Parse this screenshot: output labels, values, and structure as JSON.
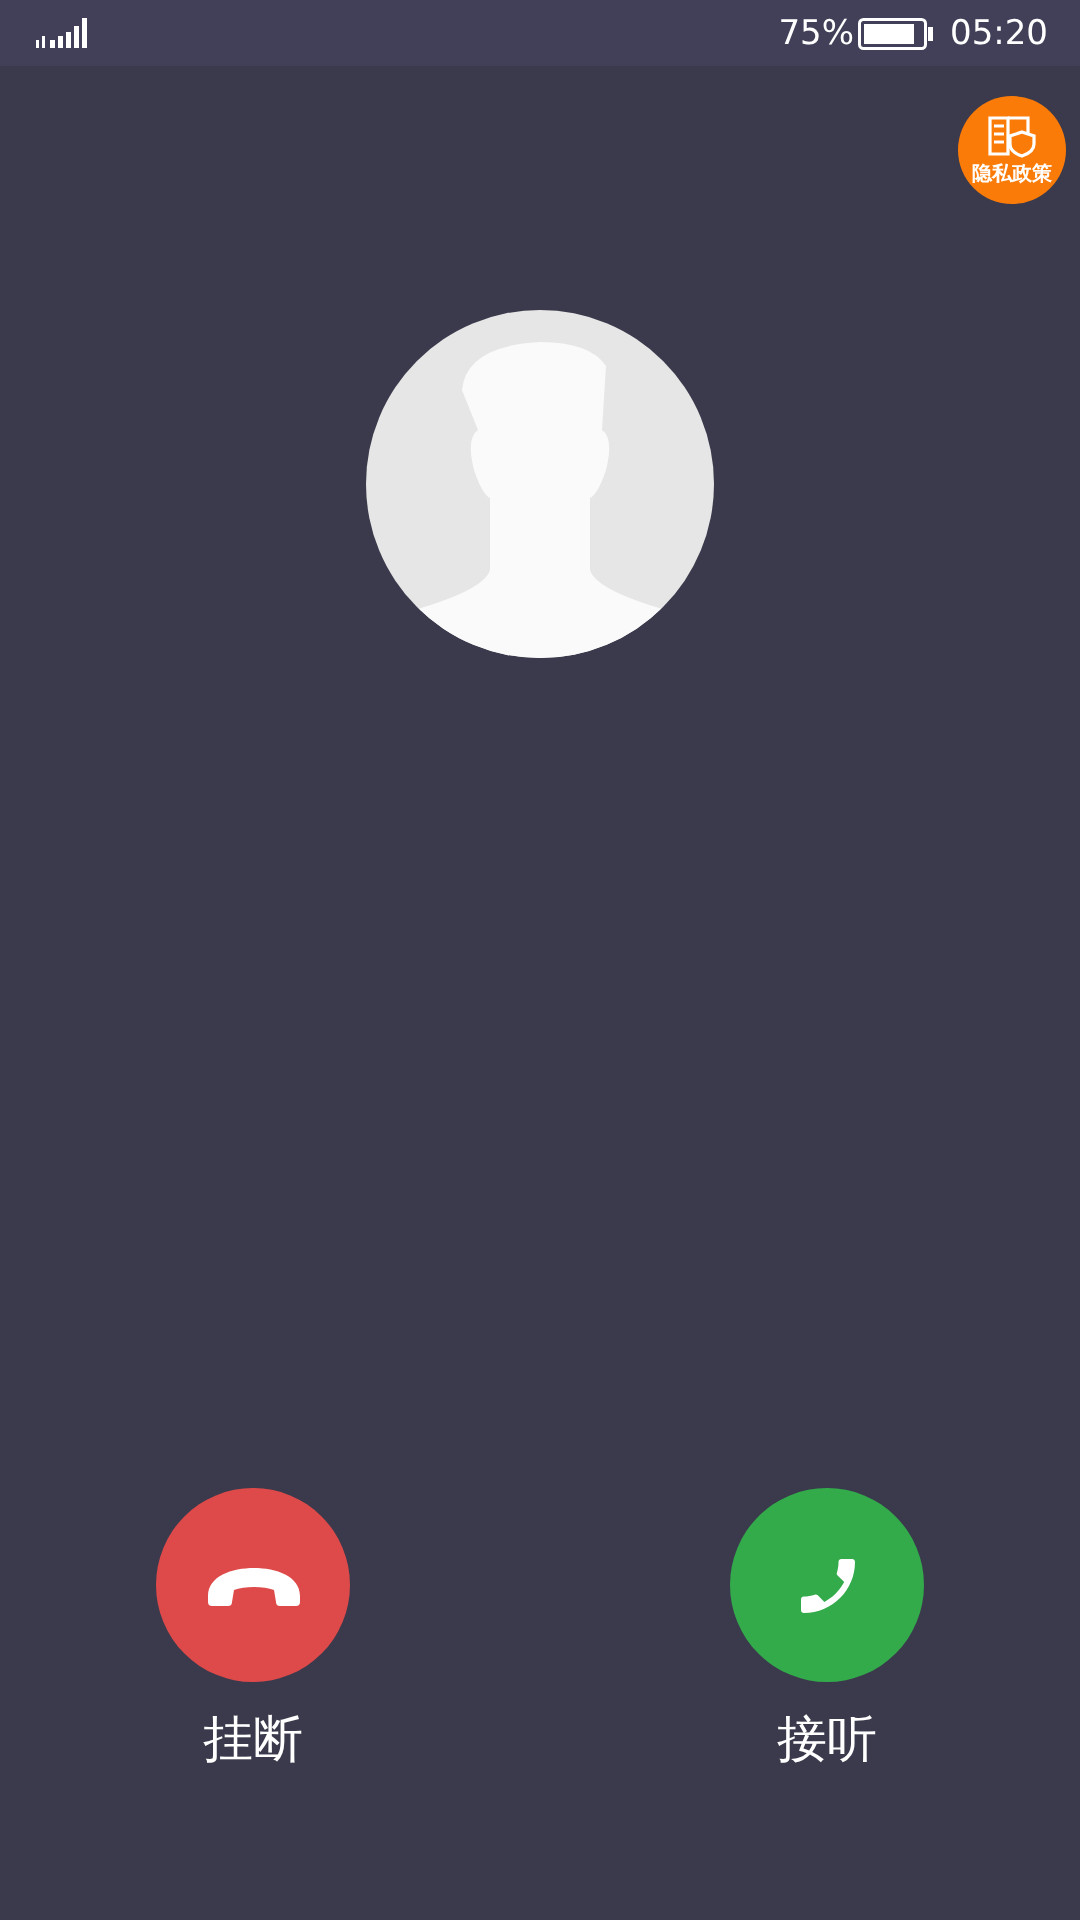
{
  "status_bar": {
    "battery": "75%",
    "time": "05:20"
  },
  "privacy_badge": {
    "label": "隐私政策"
  },
  "actions": [
    {
      "kind": "decline",
      "label": "挂断"
    },
    {
      "kind": "accept",
      "label": "接听"
    }
  ]
}
